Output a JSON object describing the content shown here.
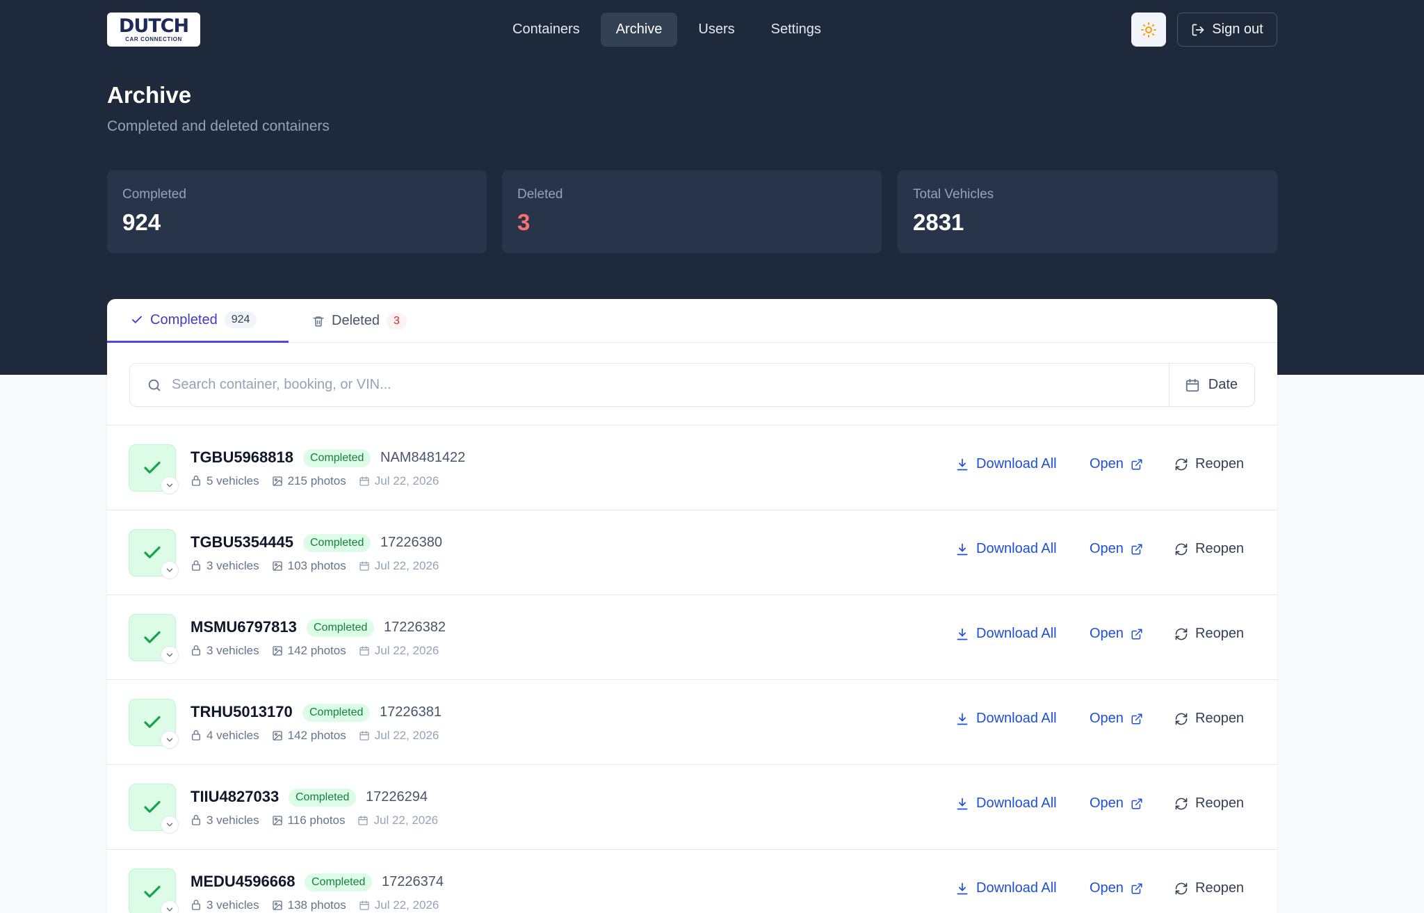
{
  "brand": {
    "logo_text": "DUTCH",
    "logo_subtext": "CAR CONNECTION"
  },
  "nav": {
    "items": [
      {
        "label": "Containers",
        "active": false
      },
      {
        "label": "Archive",
        "active": true
      },
      {
        "label": "Users",
        "active": false
      },
      {
        "label": "Settings",
        "active": false
      }
    ],
    "theme_icon": "sun-icon",
    "signout_label": "Sign out"
  },
  "header": {
    "title": "Archive",
    "subtitle": "Completed and deleted containers"
  },
  "stats": [
    {
      "label": "Completed",
      "value": "924"
    },
    {
      "label": "Deleted",
      "value": "3"
    },
    {
      "label": "Total Vehicles",
      "value": "2831"
    }
  ],
  "tabs": [
    {
      "label": "Completed",
      "count": "924",
      "icon": "check-icon",
      "active": true
    },
    {
      "label": "Deleted",
      "count": "3",
      "icon": "trash-icon",
      "active": false
    }
  ],
  "search": {
    "placeholder": "Search container, booking, or VIN...",
    "value": "",
    "date_label": "Date"
  },
  "actions": {
    "download_label": "Download All",
    "open_label": "Open",
    "reopen_label": "Reopen"
  },
  "rows": [
    {
      "container": "TGBU5968818",
      "status": "Completed",
      "booking": "NAM8481422",
      "vehicles": "5 vehicles",
      "photos": "215 photos",
      "date": "Jul 22, 2026"
    },
    {
      "container": "TGBU5354445",
      "status": "Completed",
      "booking": "17226380",
      "vehicles": "3 vehicles",
      "photos": "103 photos",
      "date": "Jul 22, 2026"
    },
    {
      "container": "MSMU6797813",
      "status": "Completed",
      "booking": "17226382",
      "vehicles": "3 vehicles",
      "photos": "142 photos",
      "date": "Jul 22, 2026"
    },
    {
      "container": "TRHU5013170",
      "status": "Completed",
      "booking": "17226381",
      "vehicles": "4 vehicles",
      "photos": "142 photos",
      "date": "Jul 22, 2026"
    },
    {
      "container": "TIIU4827033",
      "status": "Completed",
      "booking": "17226294",
      "vehicles": "3 vehicles",
      "photos": "116 photos",
      "date": "Jul 22, 2026"
    },
    {
      "container": "MEDU4596668",
      "status": "Completed",
      "booking": "17226374",
      "vehicles": "3 vehicles",
      "photos": "138 photos",
      "date": "Jul 22, 2026"
    }
  ],
  "colors": {
    "hero_bg": "#1e293b",
    "accent": "#4f46e5",
    "link": "#1d4ed8",
    "success": "#15803d",
    "danger": "#f87171"
  }
}
